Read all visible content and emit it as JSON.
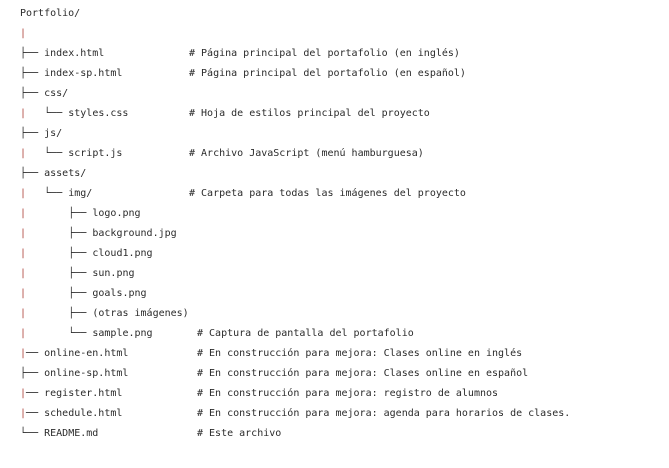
{
  "colors": {
    "text": "#2b2b2b",
    "pipe": "#b0463f"
  },
  "tree": [
    {
      "prefix": "",
      "name": "Portfolio/",
      "comment": ""
    },
    {
      "prefix": "|",
      "name": "",
      "comment": ""
    },
    {
      "prefix": "├── ",
      "name": "index.html",
      "comment": "# Página principal del portafolio (en inglés)"
    },
    {
      "prefix": "├── ",
      "name": "index-sp.html",
      "comment": "# Página principal del portafolio (en español)"
    },
    {
      "prefix": "├── ",
      "name": "css/",
      "comment": ""
    },
    {
      "prefix": "|   └── ",
      "name": "styles.css",
      "comment": "# Hoja de estilos principal del proyecto"
    },
    {
      "prefix": "├── ",
      "name": "js/",
      "comment": ""
    },
    {
      "prefix": "|   └── ",
      "name": "script.js",
      "comment": "# Archivo JavaScript (menú hamburguesa)"
    },
    {
      "prefix": "├── ",
      "name": "assets/",
      "comment": ""
    },
    {
      "prefix": "|   └── ",
      "name": "img/",
      "comment": "# Carpeta para todas las imágenes del proyecto"
    },
    {
      "prefix": "|       ├── ",
      "name": "logo.png",
      "comment": ""
    },
    {
      "prefix": "|       ├── ",
      "name": "background.jpg",
      "comment": ""
    },
    {
      "prefix": "|       ├── ",
      "name": "cloud1.png",
      "comment": ""
    },
    {
      "prefix": "|       ├── ",
      "name": "sun.png",
      "comment": ""
    },
    {
      "prefix": "|       ├── ",
      "name": "goals.png",
      "comment": ""
    },
    {
      "prefix": "|       ├── ",
      "name": "(otras imágenes)",
      "comment": ""
    },
    {
      "prefix": "|       └── ",
      "name": "sample.png",
      "comment": "# Captura de pantalla del portafolio"
    },
    {
      "prefix": "|── ",
      "name": "online-en.html",
      "comment": "# En construcción para mejora: Clases online en inglés"
    },
    {
      "prefix": "├── ",
      "name": "online-sp.html",
      "comment": "# En construcción para mejora: Clases online en español"
    },
    {
      "prefix": "|── ",
      "name": "register.html",
      "comment": "# En construcción para mejora: registro de alumnos"
    },
    {
      "prefix": "|── ",
      "name": "schedule.html",
      "comment": "# En construcción para mejora: agenda para horarios de clases."
    },
    {
      "prefix": "└── ",
      "name": "README.md",
      "comment": "# Este archivo"
    }
  ]
}
